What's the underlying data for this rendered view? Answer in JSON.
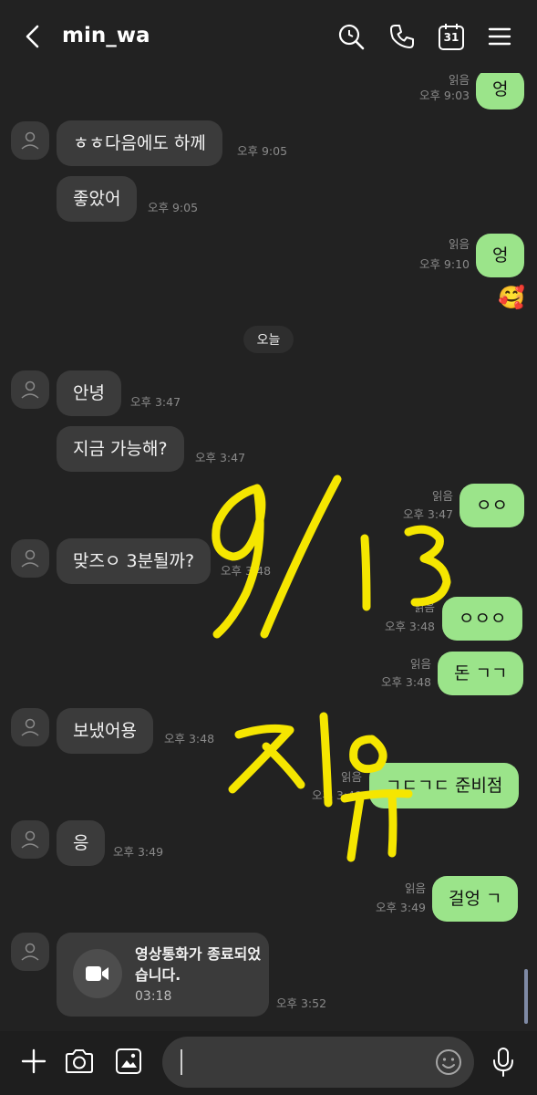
{
  "header": {
    "title": "min_wa",
    "icons": [
      "back-arrow-icon",
      "search-icon",
      "phone-icon",
      "calendar-icon",
      "menu-icon"
    ],
    "calendar_day": "31"
  },
  "date_divider": "오늘",
  "messages": [
    {
      "dir": "out",
      "text": "엉",
      "read": "읽음",
      "time": "오후 9:03"
    },
    {
      "dir": "in",
      "text": "ㅎㅎ다음에도 하께",
      "time": "오후 9:05"
    },
    {
      "dir": "in",
      "text": "좋았어",
      "time": "오후 9:05"
    },
    {
      "dir": "out",
      "text": "엉",
      "read": "읽음",
      "time": "오후 9:10"
    },
    {
      "dir": "in",
      "text": "안녕",
      "time": "오후 3:47"
    },
    {
      "dir": "in",
      "text": "지금 가능해?",
      "time": "오후 3:47"
    },
    {
      "dir": "out",
      "text": "ㅇㅇ",
      "read": "읽음",
      "time": "오후 3:47"
    },
    {
      "dir": "in",
      "text": "맞즈ㅇ 3분될까?",
      "time": "오후 3:48"
    },
    {
      "dir": "out",
      "text": "ㅇㅇㅇ",
      "read": "읽음",
      "time": "오후 3:48"
    },
    {
      "dir": "out",
      "text": "돈 ㄱㄱ",
      "read": "읽음",
      "time": "오후 3:48"
    },
    {
      "dir": "in",
      "text": "보냈어용",
      "time": "오후 3:48"
    },
    {
      "dir": "out",
      "text": "ㄱㄷㄱㄷ 준비점",
      "read": "읽음",
      "time": "오후 3:49"
    },
    {
      "dir": "in",
      "text": "응",
      "time": "오후 3:49"
    },
    {
      "dir": "out",
      "text": "걸엉 ㄱ",
      "read": "읽음",
      "time": "오후 3:49"
    }
  ],
  "reaction_emoji": "🥰",
  "video_call": {
    "title": "영상통화가 종료되었습니다.",
    "duration": "03:18",
    "time": "오후 3:52"
  },
  "input": {
    "value": "",
    "icons": [
      "plus-icon",
      "camera-icon",
      "gallery-icon",
      "emoji-icon",
      "microphone-icon"
    ]
  },
  "colors": {
    "background": "#222222",
    "incoming_bubble": "#3b3b3b",
    "outgoing_bubble": "#9be48a",
    "scribble": "#f5e600"
  }
}
